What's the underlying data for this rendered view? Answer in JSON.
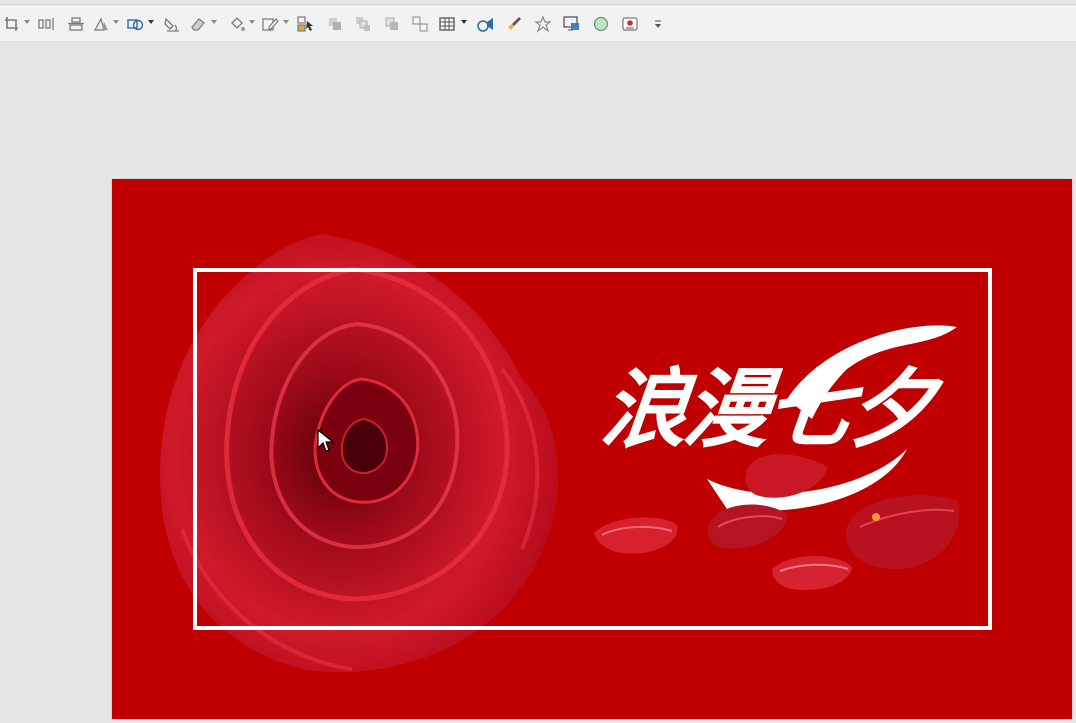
{
  "toolbar": {
    "items": [
      {
        "icon": "crop-icon",
        "dropdown": true
      },
      {
        "icon": "distribute-horizontal-icon",
        "dropdown": false
      },
      {
        "icon": "align-center-icon",
        "dropdown": false
      },
      {
        "icon": "rotate-icon",
        "dropdown": true
      },
      {
        "icon": "shapes-icon",
        "dropdown": true
      },
      {
        "icon": "fill-bucket-icon",
        "dropdown": false
      },
      {
        "icon": "eraser-icon",
        "dropdown": true
      },
      {
        "icon": "paint-icon",
        "dropdown": true
      },
      {
        "icon": "pencil-icon",
        "dropdown": true
      },
      {
        "icon": "select-objects-icon",
        "dropdown": false
      },
      {
        "icon": "bring-forward-icon",
        "dropdown": false
      },
      {
        "icon": "send-backward-icon",
        "dropdown": false
      },
      {
        "icon": "bring-to-front-icon",
        "dropdown": false
      },
      {
        "icon": "send-to-back-icon",
        "dropdown": false
      },
      {
        "icon": "table-icon",
        "dropdown": true
      },
      {
        "icon": "animation-icon",
        "dropdown": false
      },
      {
        "icon": "clean-icon",
        "dropdown": false
      },
      {
        "icon": "effects-icon",
        "dropdown": false
      },
      {
        "icon": "slide-show-icon",
        "dropdown": false
      },
      {
        "icon": "circle-shape-icon",
        "dropdown": false
      },
      {
        "icon": "record-icon",
        "dropdown": false
      },
      {
        "icon": "more-icon",
        "dropdown": false
      }
    ]
  },
  "slide": {
    "background_color": "#c00000",
    "frame_color": "#ffffff",
    "title": "浪漫七夕"
  }
}
